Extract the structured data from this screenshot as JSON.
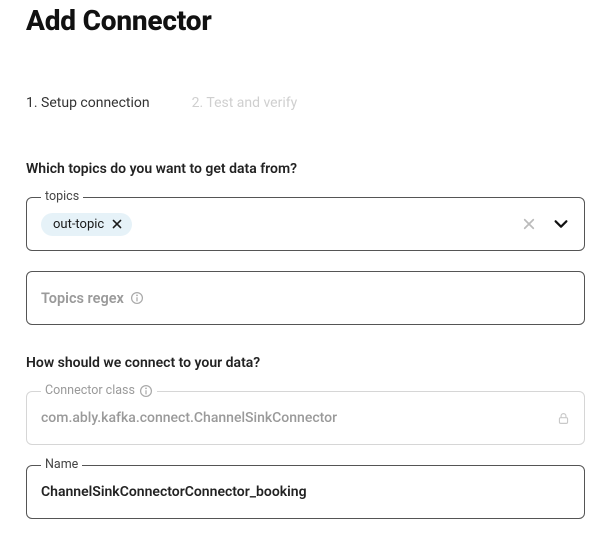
{
  "pageTitle": "Add Connector",
  "steps": {
    "step1": "1. Setup connection",
    "step2": "2. Test and verify"
  },
  "section1Label": "Which topics do you want to get data from?",
  "topics": {
    "legend": "topics",
    "chip": "out-topic"
  },
  "topicsRegex": {
    "placeholder": "Topics regex"
  },
  "section2Label": "How should we connect to your data?",
  "connectorClass": {
    "legend": "Connector class",
    "value": "com.ably.kafka.connect.ChannelSinkConnector"
  },
  "name": {
    "legend": "Name",
    "value": "ChannelSinkConnectorConnector_booking"
  }
}
